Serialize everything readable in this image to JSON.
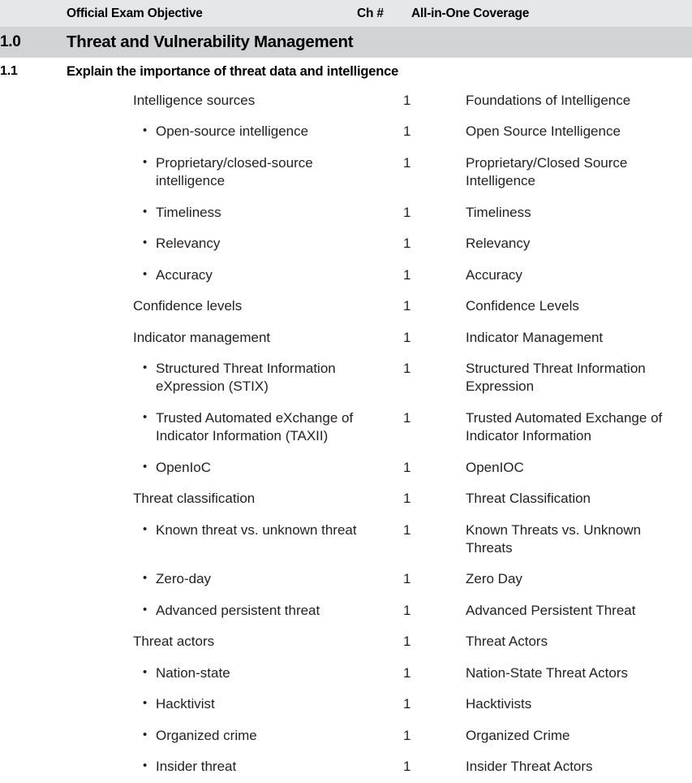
{
  "header": {
    "col_num": "",
    "col_objective": "Official Exam Objective",
    "col_chapter": "Ch #",
    "col_coverage": "All-in-One Coverage"
  },
  "section": {
    "number": "1.0",
    "title": "Threat and Vulnerability Management"
  },
  "objective": {
    "number": "1.1",
    "title": "Explain the importance of threat data and intelligence"
  },
  "colors": {
    "header_band": "#e6e7e9",
    "section_band": "#d2d3d5",
    "text": "#231f20",
    "page_background": "#ffffff"
  },
  "rows": [
    {
      "level": 0,
      "objective": "Intelligence sources",
      "chapter": "1",
      "coverage": "Foundations of Intelligence"
    },
    {
      "level": 1,
      "objective": "Open-source intelligence",
      "chapter": "1",
      "coverage": "Open Source Intelligence"
    },
    {
      "level": 1,
      "objective": "Proprietary/closed-source intelligence",
      "chapter": "1",
      "coverage": "Proprietary/Closed Source Intelligence"
    },
    {
      "level": 1,
      "objective": "Timeliness",
      "chapter": "1",
      "coverage": "Timeliness"
    },
    {
      "level": 1,
      "objective": "Relevancy",
      "chapter": "1",
      "coverage": "Relevancy"
    },
    {
      "level": 1,
      "objective": "Accuracy",
      "chapter": "1",
      "coverage": "Accuracy"
    },
    {
      "level": 0,
      "objective": "Confidence levels",
      "chapter": "1",
      "coverage": "Confidence Levels"
    },
    {
      "level": 0,
      "objective": "Indicator management",
      "chapter": "1",
      "coverage": "Indicator Management"
    },
    {
      "level": 1,
      "objective": "Structured Threat Information eXpression (STIX)",
      "chapter": "1",
      "coverage": "Structured Threat Information Expression"
    },
    {
      "level": 1,
      "objective": "Trusted Automated eXchange of Indicator Information (TAXII)",
      "chapter": "1",
      "coverage": "Trusted Automated Exchange of Indicator Information"
    },
    {
      "level": 1,
      "objective": "OpenIoC",
      "chapter": "1",
      "coverage": "OpenIOC"
    },
    {
      "level": 0,
      "objective": "Threat classification",
      "chapter": "1",
      "coverage": "Threat Classification"
    },
    {
      "level": 1,
      "objective": "Known threat vs. unknown threat",
      "chapter": "1",
      "coverage": "Known Threats vs. Unknown Threats"
    },
    {
      "level": 1,
      "objective": "Zero-day",
      "chapter": "1",
      "coverage": "Zero Day"
    },
    {
      "level": 1,
      "objective": "Advanced persistent threat",
      "chapter": "1",
      "coverage": "Advanced Persistent Threat"
    },
    {
      "level": 0,
      "objective": "Threat actors",
      "chapter": "1",
      "coverage": "Threat Actors"
    },
    {
      "level": 1,
      "objective": "Nation-state",
      "chapter": "1",
      "coverage": "Nation-State Threat Actors"
    },
    {
      "level": 1,
      "objective": "Hacktivist",
      "chapter": "1",
      "coverage": "Hacktivists"
    },
    {
      "level": 1,
      "objective": "Organized crime",
      "chapter": "1",
      "coverage": "Organized Crime"
    },
    {
      "level": 1,
      "objective": "Insider threat",
      "chapter": "1",
      "coverage": "Insider Threat Actors"
    }
  ],
  "bullet_glyph": "•"
}
